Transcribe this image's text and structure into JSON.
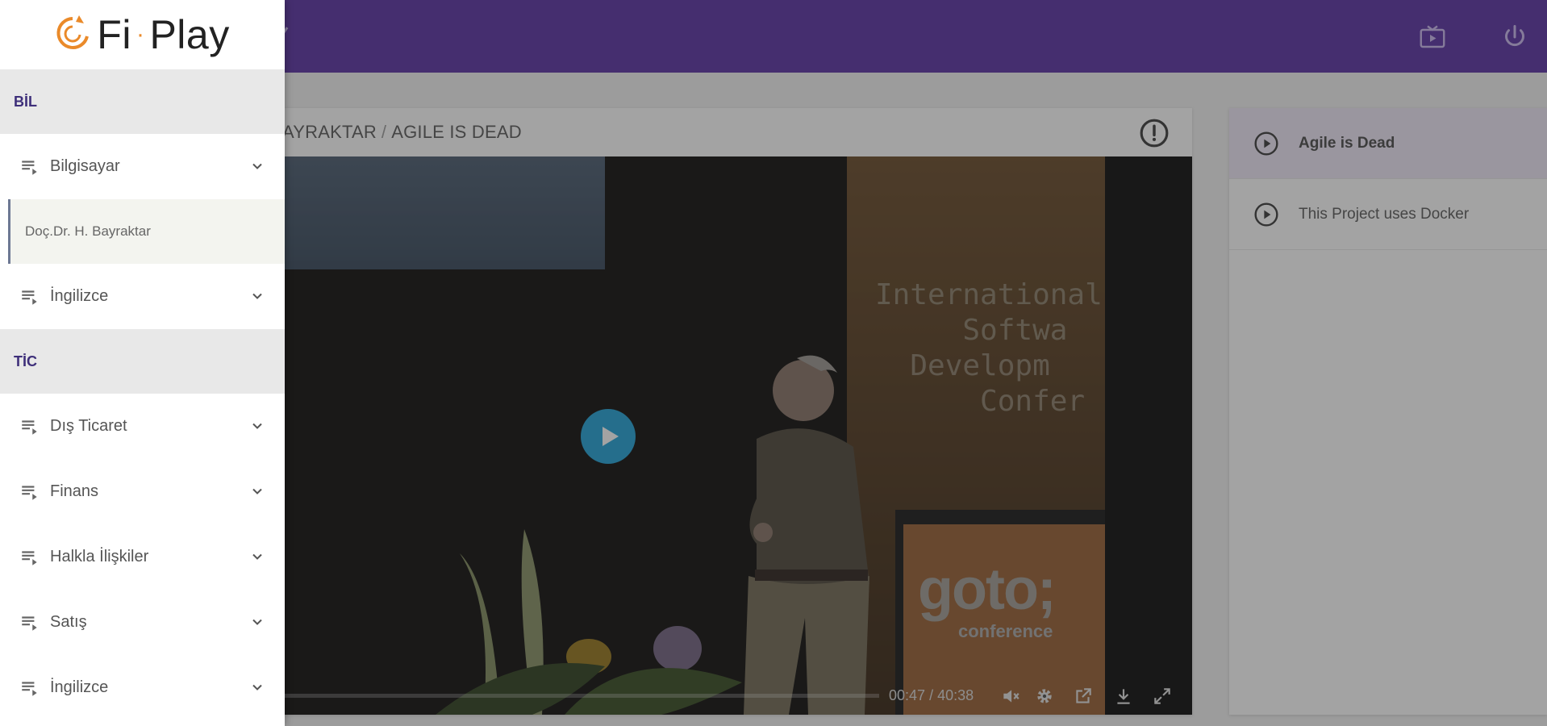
{
  "app": {
    "logo_text_left": "Fi",
    "logo_dot": "·",
    "logo_text_right": "Play",
    "brand_color": "#542aa0",
    "accent_color": "#ea8a2a"
  },
  "topbar": {
    "icons": [
      "live-tv-icon",
      "power-icon"
    ]
  },
  "sidebar": {
    "sections": [
      {
        "title": "BİL",
        "items": [
          {
            "label": "Bilgisayar",
            "expanded": true,
            "children": [
              "Doç.Dr. H. Bayraktar"
            ]
          },
          {
            "label": "İngilizce",
            "expanded": false
          }
        ]
      },
      {
        "title": "TİC",
        "items": [
          {
            "label": "Dış Ticaret"
          },
          {
            "label": "Finans"
          },
          {
            "label": "Halkla İlişkiler"
          },
          {
            "label": "Satış"
          },
          {
            "label": "İngilizce"
          }
        ]
      }
    ]
  },
  "main": {
    "breadcrumb_part": "AYRAKTAR",
    "breadcrumb_sep": "/",
    "breadcrumb_title": "AGILE IS DEAD"
  },
  "video": {
    "current_time": "00:47",
    "time_sep": "/",
    "duration": "40:38",
    "progress": 0.019,
    "play_color": "#1a9fd6",
    "stage_text": "International\n     Softwa\n  Developm\n      Confer",
    "podium_brand": "goto;",
    "podium_sub": "conference"
  },
  "playlist": {
    "items": [
      {
        "label": "Agile is Dead",
        "active": true
      },
      {
        "label": "This Project uses Docker",
        "active": false
      }
    ]
  }
}
